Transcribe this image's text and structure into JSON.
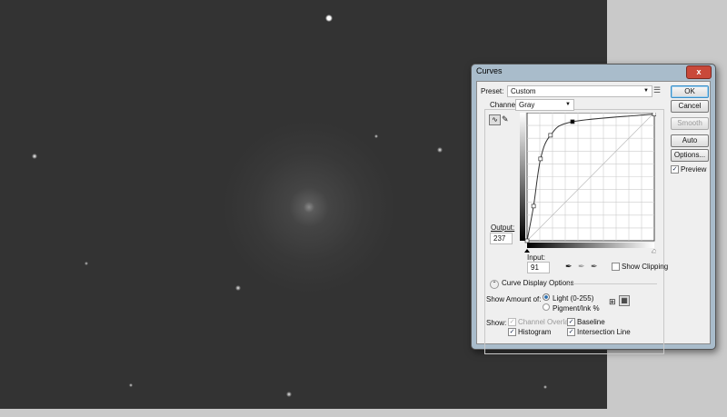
{
  "dialog": {
    "title": "Curves",
    "close_label": "x"
  },
  "preset": {
    "label": "Preset:",
    "value": "Custom"
  },
  "channel": {
    "label": "Channel:",
    "value": "Gray"
  },
  "buttons": {
    "ok": "OK",
    "cancel": "Cancel",
    "smooth": "Smooth",
    "auto": "Auto",
    "options": "Options...",
    "preview": "Preview",
    "preview_checked": true
  },
  "output": {
    "label": "Output:",
    "value": "237"
  },
  "input": {
    "label": "Input:",
    "value": "91"
  },
  "show_clipping": {
    "label": "Show Clipping",
    "checked": false
  },
  "curve_display_options": "Curve Display Options",
  "show_amount": {
    "label": "Show Amount of:",
    "light": "Light  (0-255)",
    "pigment": "Pigment/Ink %",
    "selected": "light"
  },
  "show": {
    "label": "Show:",
    "channel_overlays": "Channel Overlays",
    "baseline": "Baseline",
    "histogram": "Histogram",
    "intersection_line": "Intersection Line"
  },
  "chart_data": {
    "type": "line",
    "title": "Curves",
    "xlim": [
      0,
      255
    ],
    "ylim": [
      0,
      255
    ],
    "points": [
      [
        0,
        0
      ],
      [
        13,
        69
      ],
      [
        27,
        163
      ],
      [
        47,
        210
      ],
      [
        91,
        237
      ],
      [
        255,
        252
      ]
    ],
    "selected_point": [
      91,
      237
    ]
  }
}
